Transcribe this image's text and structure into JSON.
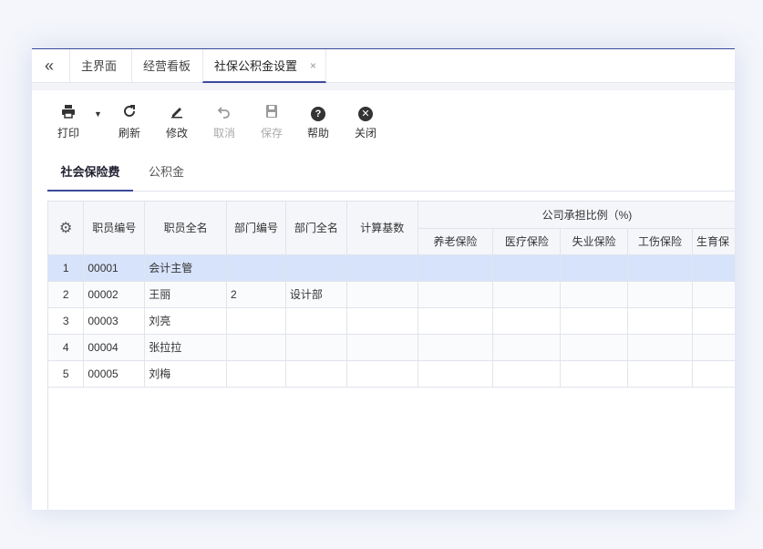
{
  "tabs": {
    "collapse_icon": "double-chevron-left-icon",
    "items": [
      {
        "label": "主界面"
      },
      {
        "label": "经营看板"
      },
      {
        "label": "社保公积金设置",
        "close": "×"
      }
    ]
  },
  "toolbar": {
    "print": "打印",
    "refresh": "刷新",
    "edit": "修改",
    "cancel": "取消",
    "save": "保存",
    "help": "帮助",
    "close": "关闭"
  },
  "subtabs": {
    "social": "社会保险费",
    "fund": "公积金"
  },
  "grid": {
    "headers": {
      "emp_no": "职员编号",
      "emp_name": "职员全名",
      "dept_no": "部门编号",
      "dept_name": "部门全名",
      "base": "计算基数",
      "group": "公司承担比例（%)",
      "pension": "养老保险",
      "medical": "医疗保险",
      "unemployment": "失业保险",
      "injury": "工伤保险",
      "maternity": "生育保"
    },
    "rows": [
      {
        "n": "1",
        "emp_no": "00001",
        "emp_name": "会计主管",
        "dept_no": "",
        "dept_name": ""
      },
      {
        "n": "2",
        "emp_no": "00002",
        "emp_name": "王丽",
        "dept_no": "2",
        "dept_name": "设计部"
      },
      {
        "n": "3",
        "emp_no": "00003",
        "emp_name": "刘亮",
        "dept_no": "",
        "dept_name": ""
      },
      {
        "n": "4",
        "emp_no": "00004",
        "emp_name": "张拉拉",
        "dept_no": "",
        "dept_name": ""
      },
      {
        "n": "5",
        "emp_no": "00005",
        "emp_name": "刘梅",
        "dept_no": "",
        "dept_name": ""
      }
    ]
  },
  "colors": {
    "accent": "#3b4a9a",
    "selected_row": "#d7e3fb"
  }
}
